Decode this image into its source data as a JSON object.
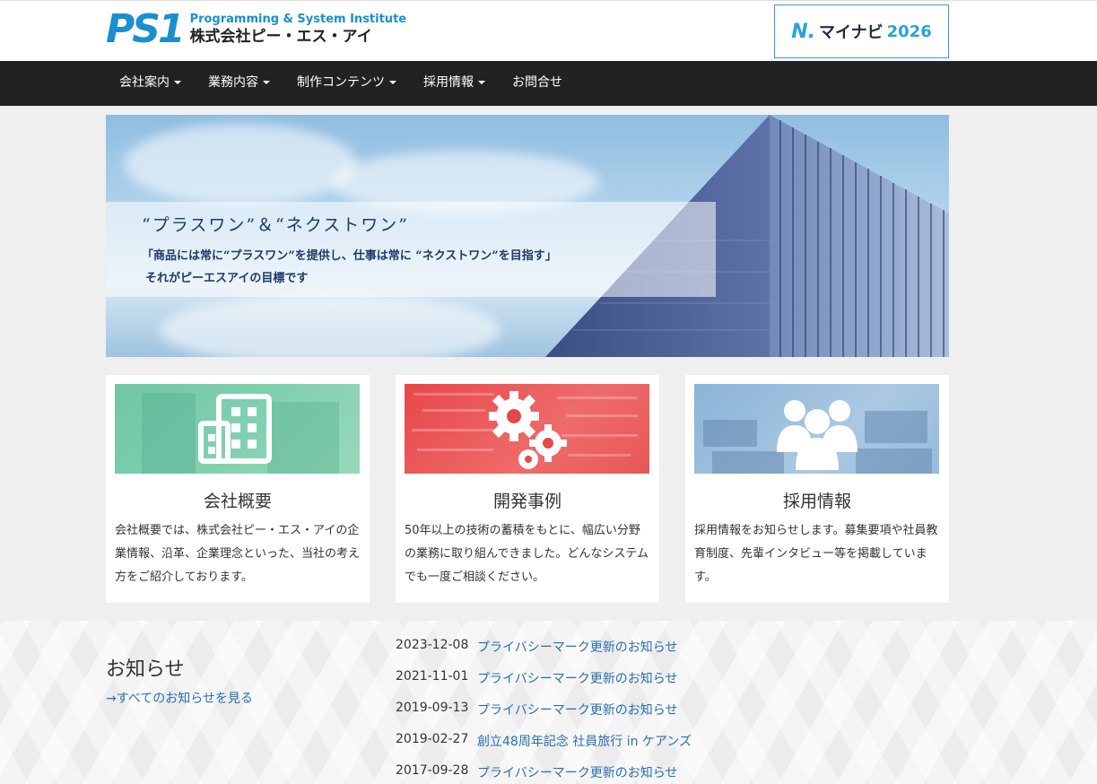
{
  "header": {
    "logo_mark": "PS1",
    "logo_en": "Programming & System Institute",
    "logo_ja": "株式会社ピー・エス・アイ",
    "mynavi": {
      "icon": "N.",
      "label": "マイナビ",
      "year": "2026",
      "border_color": "#29a3d8"
    }
  },
  "nav": {
    "items": [
      {
        "label": "会社案内",
        "dropdown": true
      },
      {
        "label": "業務内容",
        "dropdown": true
      },
      {
        "label": "制作コンテンツ",
        "dropdown": true
      },
      {
        "label": "採用情報",
        "dropdown": true
      },
      {
        "label": "お問合せ",
        "dropdown": false
      }
    ]
  },
  "hero": {
    "title": "“プラスワン”＆“ネクストワン”",
    "line1": "「商品には常に“プラスワン”を提供し、仕事は常に “ネクストワン”を目指す」",
    "line2": "それがピーエスアイの目標です"
  },
  "cards": [
    {
      "title": "会社概要",
      "icon": "building-icon",
      "text": "会社概要では、株式会社ピー・エス・アイの企業情報、沿革、企業理念といった、当社の考え方をご紹介しております。"
    },
    {
      "title": "開発事例",
      "icon": "gears-icon",
      "text": "50年以上の技術の蓄積をもとに、幅広い分野の業務に取り組んできました。どんなシステムでも一度ご相談ください。"
    },
    {
      "title": "採用情報",
      "icon": "people-icon",
      "text": "採用情報をお知らせします。募集要項や社員教育制度、先輩インタビュー等を掲載しています。"
    }
  ],
  "news": {
    "heading": "お知らせ",
    "all_link": "→すべてのお知らせを見る",
    "items": [
      {
        "date": "2023-12-08",
        "title": "プライバシーマーク更新のお知らせ"
      },
      {
        "date": "2021-11-01",
        "title": "プライバシーマーク更新のお知らせ"
      },
      {
        "date": "2019-09-13",
        "title": "プライバシーマーク更新のお知らせ"
      },
      {
        "date": "2019-02-27",
        "title": "創立48周年記念 社員旅行 in ケアンズ"
      },
      {
        "date": "2017-09-28",
        "title": "プライバシーマーク更新のお知らせ"
      }
    ]
  },
  "colors": {
    "brand": "#1a8fd0",
    "nav_bg": "#222222",
    "link": "#2a6fb0"
  }
}
